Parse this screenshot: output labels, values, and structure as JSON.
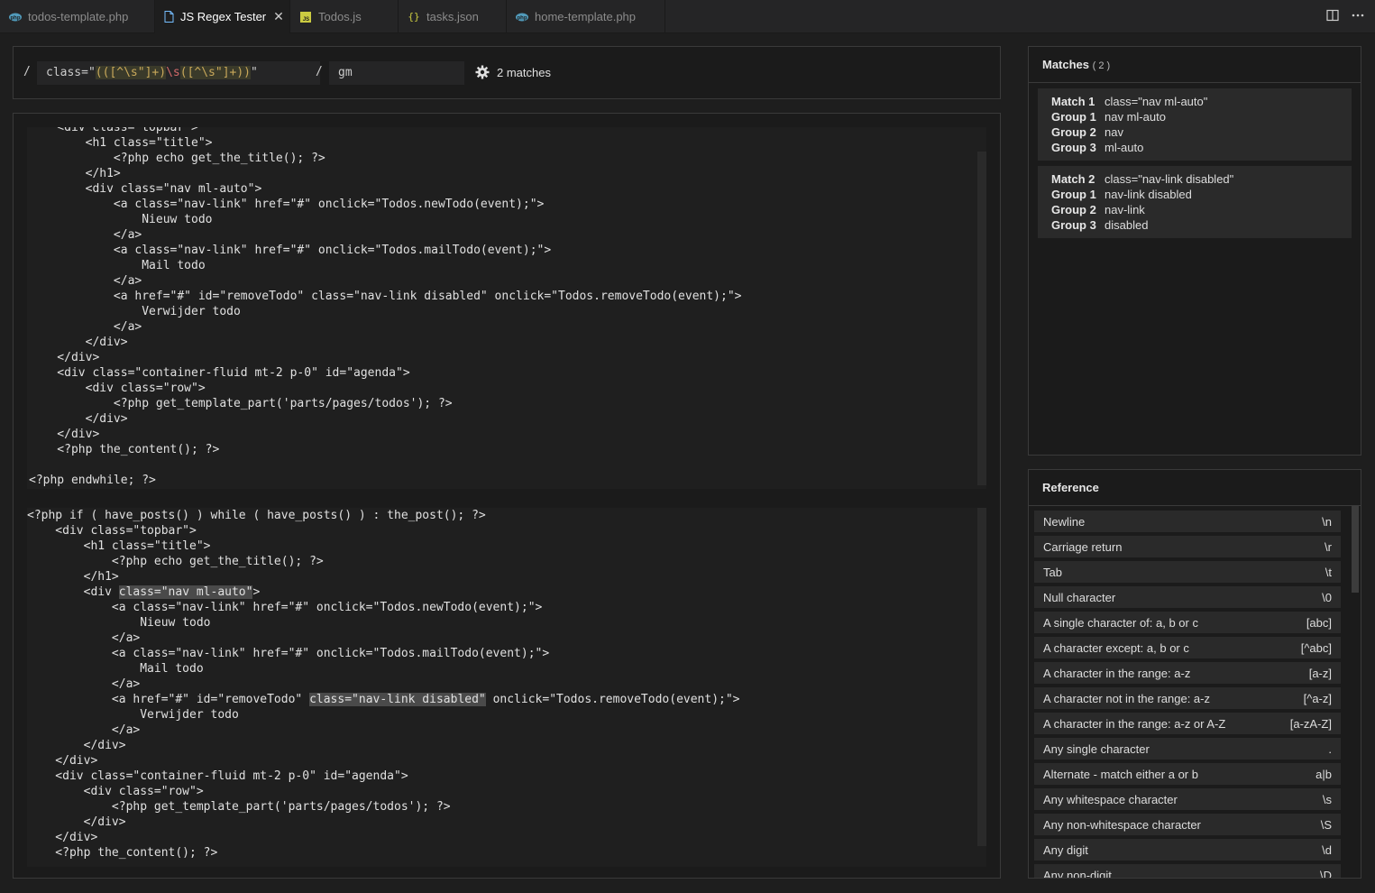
{
  "tabs": [
    {
      "label": "todos-template.php",
      "icon": "php-file-icon",
      "active": false
    },
    {
      "label": "JS Regex Tester",
      "icon": "document-icon",
      "active": true
    },
    {
      "label": "Todos.js",
      "icon": "js-file-icon",
      "active": false
    },
    {
      "label": "tasks.json",
      "icon": "json-file-icon",
      "active": false
    },
    {
      "label": "home-template.php",
      "icon": "php-file-icon",
      "active": false
    }
  ],
  "regex": {
    "open_slash": "/",
    "close_slash": "/",
    "prefix": "class=\"",
    "g1_open": "((",
    "class1": "[^\\s\"]",
    "plus1": "+)",
    "esc_s": "\\s",
    "g3_open": "(",
    "class2": "[^\\s\"]",
    "plus2": "+))",
    "suffix": "\"",
    "flags": "gm",
    "match_count": "2 matches"
  },
  "code_top": [
    "    <div class=\"topbar\">",
    "        <h1 class=\"title\">",
    "            <?php echo get_the_title(); ?>",
    "        </h1>",
    "        <div class=\"nav ml-auto\">",
    "            <a class=\"nav-link\" href=\"#\" onclick=\"Todos.newTodo(event);\">",
    "                Nieuw todo",
    "            </a>",
    "            <a class=\"nav-link\" href=\"#\" onclick=\"Todos.mailTodo(event);\">",
    "                Mail todo",
    "            </a>",
    "            <a href=\"#\" id=\"removeTodo\" class=\"nav-link disabled\" onclick=\"Todos.removeTodo(event);\">",
    "                Verwijder todo",
    "            </a>",
    "        </div>",
    "    </div>",
    "    <div class=\"container-fluid mt-2 p-0\" id=\"agenda\">",
    "        <div class=\"row\">",
    "            <?php get_template_part('parts/pages/todos'); ?>",
    "        </div>",
    "    </div>",
    "    <?php the_content(); ?>",
    "",
    "<?php endwhile; ?>"
  ],
  "code_bottom": {
    "l0": "<?php if ( have_posts() ) while ( have_posts() ) : the_post(); ?>",
    "l1": "    <div class=\"topbar\">",
    "l2": "        <h1 class=\"title\">",
    "l3": "            <?php echo get_the_title(); ?>",
    "l4": "        </h1>",
    "l5a": "        <div ",
    "l5m": "class=\"nav ml-auto\"",
    "l5b": ">",
    "l6": "            <a class=\"nav-link\" href=\"#\" onclick=\"Todos.newTodo(event);\">",
    "l7": "                Nieuw todo",
    "l8": "            </a>",
    "l9": "            <a class=\"nav-link\" href=\"#\" onclick=\"Todos.mailTodo(event);\">",
    "l10": "                Mail todo",
    "l11": "            </a>",
    "l12a": "            <a href=\"#\" id=\"removeTodo\" ",
    "l12m": "class=\"nav-link disabled\"",
    "l12b": " onclick=\"Todos.removeTodo(event);\">",
    "l13": "                Verwijder todo",
    "l14": "            </a>",
    "l15": "        </div>",
    "l16": "    </div>",
    "l17": "    <div class=\"container-fluid mt-2 p-0\" id=\"agenda\">",
    "l18": "        <div class=\"row\">",
    "l19": "            <?php get_template_part('parts/pages/todos'); ?>",
    "l20": "        </div>",
    "l21": "    </div>",
    "l22": "    <?php the_content(); ?>"
  },
  "matches": {
    "title": "Matches",
    "count": "( 2 )",
    "items": [
      {
        "rows": [
          {
            "k": "Match 1",
            "v": "class=\"nav ml-auto\""
          },
          {
            "k": "Group 1",
            "v": "nav ml-auto"
          },
          {
            "k": "Group 2",
            "v": "nav"
          },
          {
            "k": "Group 3",
            "v": "ml-auto"
          }
        ]
      },
      {
        "rows": [
          {
            "k": "Match 2",
            "v": "class=\"nav-link disabled\""
          },
          {
            "k": "Group 1",
            "v": "nav-link disabled"
          },
          {
            "k": "Group 2",
            "v": "nav-link"
          },
          {
            "k": "Group 3",
            "v": "disabled"
          }
        ]
      }
    ]
  },
  "reference": {
    "title": "Reference",
    "items": [
      {
        "label": "Newline",
        "sym": "\\n"
      },
      {
        "label": "Carriage return",
        "sym": "\\r"
      },
      {
        "label": "Tab",
        "sym": "\\t"
      },
      {
        "label": "Null character",
        "sym": "\\0"
      },
      {
        "label": "A single character of: a, b or c",
        "sym": "[abc]"
      },
      {
        "label": "A character except: a, b or c",
        "sym": "[^abc]"
      },
      {
        "label": "A character in the range: a-z",
        "sym": "[a-z]"
      },
      {
        "label": "A character not in the range: a-z",
        "sym": "[^a-z]"
      },
      {
        "label": "A character in the range: a-z or A-Z",
        "sym": "[a-zA-Z]"
      },
      {
        "label": "Any single character",
        "sym": "."
      },
      {
        "label": "Alternate - match either a or b",
        "sym": "a|b"
      },
      {
        "label": "Any whitespace character",
        "sym": "\\s"
      },
      {
        "label": "Any non-whitespace character",
        "sym": "\\S"
      },
      {
        "label": "Any digit",
        "sym": "\\d"
      },
      {
        "label": "Any non-digit",
        "sym": "\\D"
      }
    ]
  },
  "colors": {
    "background": "#1e1e1e",
    "panel": "#1b1b1b",
    "highlight": "#4a4a4a",
    "php_icon": "#519aba",
    "js_icon": "#cbcb41"
  }
}
